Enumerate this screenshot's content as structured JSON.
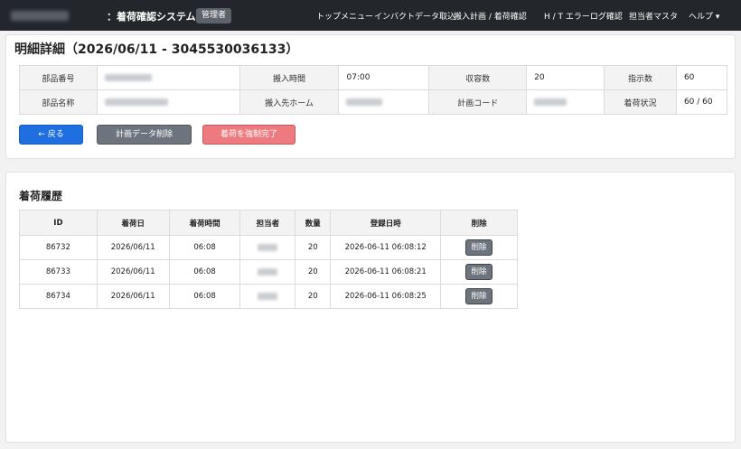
{
  "navbar": {
    "brand": "：着荷確認システム",
    "role_badge": "管理者",
    "links": [
      "トップメニュー",
      "インバクトデータ取込",
      "搬入計画 / 着荷確認",
      "H / T エラーログ確認",
      "担当者マスタ",
      "ヘルプ ▾"
    ]
  },
  "page": {
    "title": "明細詳細（2026/06/11 - 3045530036133）"
  },
  "detail": {
    "labels": {
      "part_no": "部品番号",
      "delivery_time": "搬入時間",
      "received_qty": "収容数",
      "instruction_qty": "指示数",
      "part_name": "部品名称",
      "delivery_home": "搬入先ホーム",
      "plan_code": "計画コード",
      "arrival_status": "着荷状況"
    },
    "values": {
      "delivery_time": "07:00",
      "received_qty": "20",
      "instruction_qty": "60",
      "arrival_status": "60 / 60"
    }
  },
  "buttons": {
    "back": "← 戻る",
    "delete_plan": "計画データ削除",
    "force_complete": "着荷を強制完了"
  },
  "history": {
    "title": "着荷履歴",
    "columns": [
      "ID",
      "着荷日",
      "着荷時間",
      "担当者",
      "数量",
      "登録日時",
      "削除"
    ],
    "rows": [
      {
        "id": "86732",
        "date": "2026/06/11",
        "time": "06:08",
        "qty": "20",
        "registered": "2026-06-11 06:08:12",
        "delete": "削除"
      },
      {
        "id": "86733",
        "date": "2026/06/11",
        "time": "06:08",
        "qty": "20",
        "registered": "2026-06-11 06:08:21",
        "delete": "削除"
      },
      {
        "id": "86734",
        "date": "2026/06/11",
        "time": "06:08",
        "qty": "20",
        "registered": "2026-06-11 06:08:25",
        "delete": "削除"
      }
    ]
  }
}
